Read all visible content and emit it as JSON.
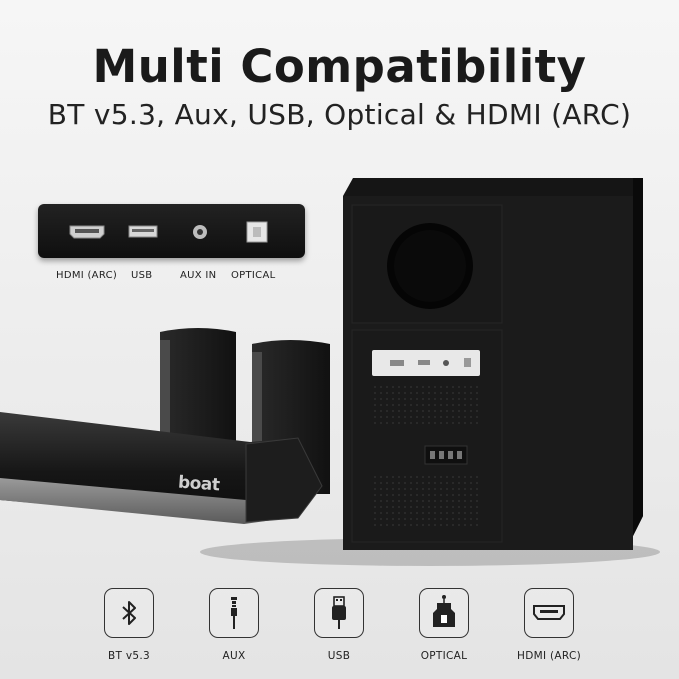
{
  "header": {
    "title": "Multi Compatibility",
    "subtitle": "BT v5.3, Aux, USB, Optical & HDMI (ARC)"
  },
  "port_panel": {
    "labels": [
      "HDMI (ARC)",
      "USB",
      "AUX IN",
      "OPTICAL"
    ]
  },
  "product": {
    "brand_logo_text": "boat"
  },
  "connectivity": [
    {
      "label": "BT v5.3",
      "icon": "bluetooth-icon"
    },
    {
      "label": "AUX",
      "icon": "aux-jack-icon"
    },
    {
      "label": "USB",
      "icon": "usb-icon"
    },
    {
      "label": "OPTICAL",
      "icon": "optical-connector-icon"
    },
    {
      "label": "HDMI (ARC)",
      "icon": "hdmi-port-icon"
    }
  ]
}
